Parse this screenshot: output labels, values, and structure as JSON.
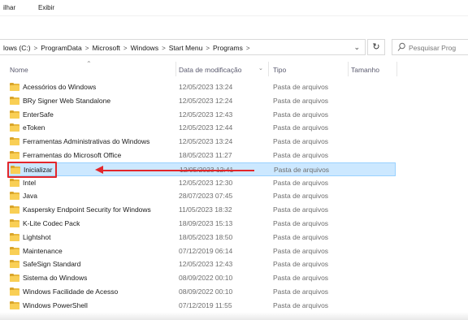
{
  "menu": {
    "items": [
      "ilhar",
      "Exibir"
    ]
  },
  "address": {
    "crumbs": [
      "lows (C:)",
      "ProgramData",
      "Microsoft",
      "Windows",
      "Start Menu",
      "Programs"
    ],
    "dropdown_icon": "chevron-down-icon",
    "refresh_icon": "refresh-icon"
  },
  "search": {
    "placeholder": "Pesquisar Prog"
  },
  "columns": {
    "name": "Nome",
    "date": "Data de modificação",
    "type": "Tipo",
    "size": "Tamanho"
  },
  "files": [
    {
      "name": "Acessórios do Windows",
      "date": "12/05/2023 13:24",
      "type": "Pasta de arquivos"
    },
    {
      "name": "BRy Signer Web Standalone",
      "date": "12/05/2023 12:24",
      "type": "Pasta de arquivos"
    },
    {
      "name": "EnterSafe",
      "date": "12/05/2023 12:43",
      "type": "Pasta de arquivos"
    },
    {
      "name": "eToken",
      "date": "12/05/2023 12:44",
      "type": "Pasta de arquivos"
    },
    {
      "name": "Ferramentas Administrativas do Windows",
      "date": "12/05/2023 13:24",
      "type": "Pasta de arquivos"
    },
    {
      "name": "Ferramentas do Microsoft Office",
      "date": "18/05/2023 11:27",
      "type": "Pasta de arquivos"
    },
    {
      "name": "Inicializar",
      "date": "12/05/2023 12:41",
      "type": "Pasta de arquivos",
      "selected": true
    },
    {
      "name": "Intel",
      "date": "12/05/2023 12:30",
      "type": "Pasta de arquivos"
    },
    {
      "name": "Java",
      "date": "28/07/2023 07:45",
      "type": "Pasta de arquivos"
    },
    {
      "name": "Kaspersky Endpoint Security for Windows",
      "date": "11/05/2023 18:32",
      "type": "Pasta de arquivos"
    },
    {
      "name": "K-Lite Codec Pack",
      "date": "18/09/2023 15:13",
      "type": "Pasta de arquivos"
    },
    {
      "name": "Lightshot",
      "date": "18/05/2023 18:50",
      "type": "Pasta de arquivos"
    },
    {
      "name": "Maintenance",
      "date": "07/12/2019 06:14",
      "type": "Pasta de arquivos"
    },
    {
      "name": "SafeSign Standard",
      "date": "12/05/2023 12:43",
      "type": "Pasta de arquivos"
    },
    {
      "name": "Sistema do Windows",
      "date": "08/09/2022 00:10",
      "type": "Pasta de arquivos"
    },
    {
      "name": "Windows Facilidade de Acesso",
      "date": "08/09/2022 00:10",
      "type": "Pasta de arquivos"
    },
    {
      "name": "Windows PowerShell",
      "date": "07/12/2019 11:55",
      "type": "Pasta de arquivos"
    }
  ],
  "colors": {
    "accent": "#e3262b",
    "selection": "#cce8ff",
    "folder": "#f9cf55"
  }
}
